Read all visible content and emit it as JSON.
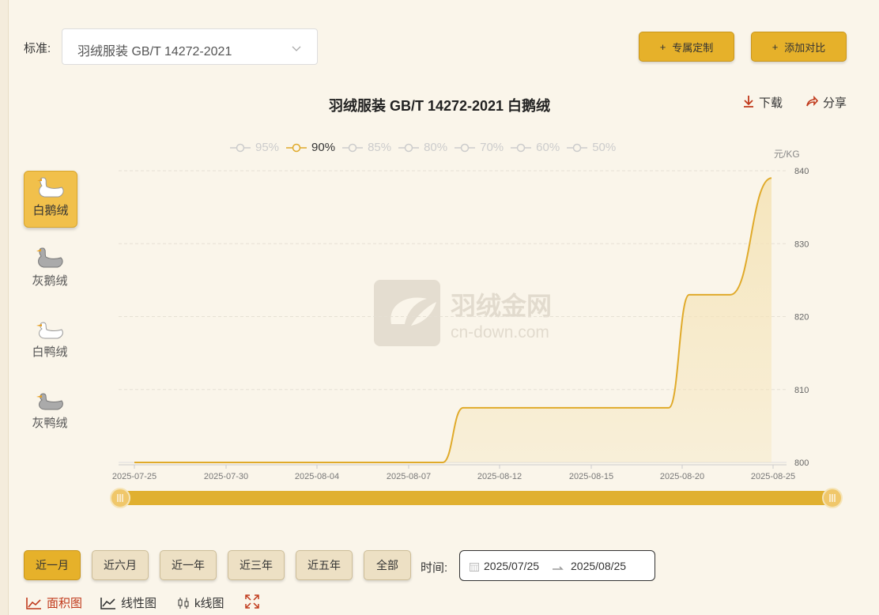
{
  "standard": {
    "label": "标准:",
    "value": "羽绒服装 GB/T 14272-2021"
  },
  "buttons": {
    "custom": "专属定制",
    "compare": "添加对比"
  },
  "chart_header": {
    "title": "羽绒服装 GB/T 14272-2021 白鹅绒",
    "download": "下载",
    "share": "分享"
  },
  "legend": [
    {
      "name": "95%",
      "active": false
    },
    {
      "name": "90%",
      "active": true
    },
    {
      "name": "85%",
      "active": false
    },
    {
      "name": "80%",
      "active": false
    },
    {
      "name": "70%",
      "active": false
    },
    {
      "name": "60%",
      "active": false
    },
    {
      "name": "50%",
      "active": false
    }
  ],
  "side_items": [
    {
      "label": "白鹅绒",
      "icon": "white-goose-icon",
      "active": true
    },
    {
      "label": "灰鹅绒",
      "icon": "grey-goose-icon",
      "active": false
    },
    {
      "label": "白鸭绒",
      "icon": "white-duck-icon",
      "active": false
    },
    {
      "label": "灰鸭绒",
      "icon": "grey-duck-icon",
      "active": false
    }
  ],
  "watermark": {
    "name": "羽绒金网",
    "url": "cn-down.com"
  },
  "ranges": [
    "近一月",
    "近六月",
    "近一年",
    "近三年",
    "近五年",
    "全部"
  ],
  "time": {
    "label": "时间:",
    "start": "2025/07/25",
    "end": "2025/08/25"
  },
  "views": [
    "面积图",
    "线性图",
    "k线图"
  ],
  "colors": {
    "accent": "#e6b12a",
    "line": "#e0aa2a"
  },
  "chart_data": {
    "type": "area",
    "ylabel": "元/KG",
    "ylim": [
      800,
      840
    ],
    "yticks": [
      800,
      810,
      820,
      830,
      840
    ],
    "x_ticks": [
      "2025-07-25",
      "2025-07-30",
      "2025-08-04",
      "2025-08-07",
      "2025-08-12",
      "2025-08-15",
      "2025-08-20",
      "2025-08-25"
    ],
    "series": [
      {
        "name": "90%",
        "points": [
          {
            "x": "2025-07-25",
            "y": 800
          },
          {
            "x": "2025-08-07",
            "y": 800
          },
          {
            "x": "2025-08-09",
            "y": 800
          },
          {
            "x": "2025-08-10",
            "y": 807.5
          },
          {
            "x": "2025-08-19",
            "y": 807.5
          },
          {
            "x": "2025-08-20",
            "y": 807.5
          },
          {
            "x": "2025-08-21",
            "y": 823
          },
          {
            "x": "2025-08-23",
            "y": 823
          },
          {
            "x": "2025-08-25",
            "y": 839
          }
        ]
      }
    ]
  }
}
